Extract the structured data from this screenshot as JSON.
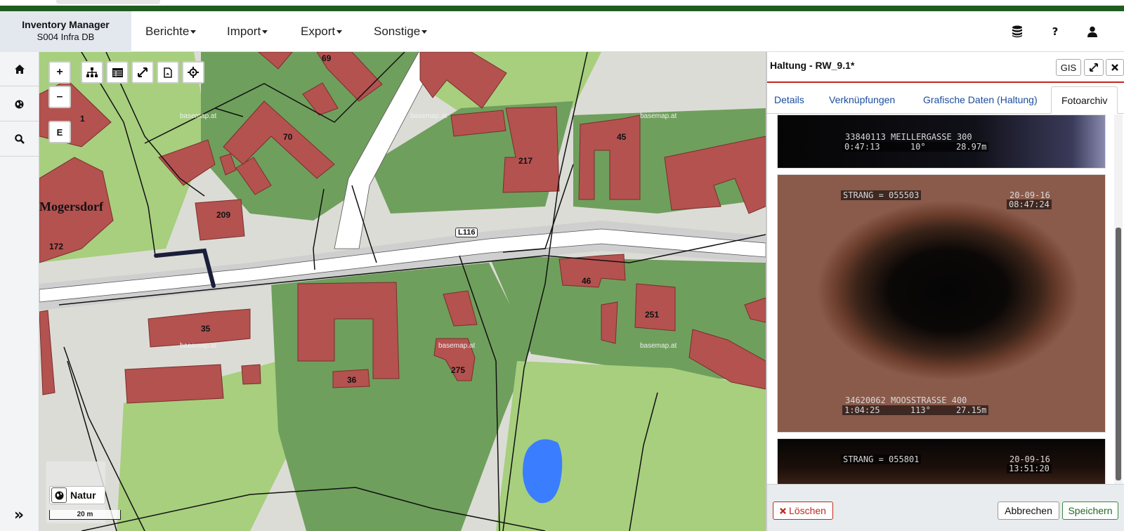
{
  "brand": {
    "title": "Inventory Manager",
    "subtitle": "S004 Infra DB"
  },
  "menu": [
    {
      "label": "Berichte"
    },
    {
      "label": "Import"
    },
    {
      "label": "Export"
    },
    {
      "label": "Sonstige"
    }
  ],
  "nav_icons": {
    "database": "database-icon",
    "help_label": "?",
    "user": "user-icon"
  },
  "sidebar": [
    "home-icon",
    "globe-icon",
    "search-icon"
  ],
  "map": {
    "toolbar": {
      "zoom_in": "+",
      "zoom_out": "–",
      "extent": "E"
    },
    "labels": {
      "town": "Mogersdorf",
      "road": "L116",
      "n69": "69",
      "n1": "1",
      "n70": "70",
      "n217": "217",
      "n45": "45",
      "n209": "209",
      "n172": "172",
      "n46": "46",
      "n251": "251",
      "n35": "35",
      "n275": "275",
      "n36": "36"
    },
    "watermark": "basemap.at",
    "layer": "Natur",
    "scale": "20 m",
    "colors": {
      "building": "#b45250",
      "green_dark": "#6f9f5c",
      "green_light": "#a7cf7e",
      "road": "#ffffff",
      "water": "#3a7dff"
    }
  },
  "panel": {
    "title": "Haltung - RW_9.1*",
    "gis_label": "GIS",
    "tabs": [
      {
        "label": "Details"
      },
      {
        "label": "Verknüpfungen"
      },
      {
        "label": "Grafische Daten (Haltung)"
      },
      {
        "label": "Fotoarchiv",
        "active": true
      }
    ],
    "photos": [
      {
        "line1": "33840113 MEILLERGASSE 300",
        "line2": "0:47:13      10°      28.97m"
      },
      {
        "strang": "STRANG = 055503",
        "date": "20-09-16",
        "time": "08:47:24",
        "line1": "34620062 MOOSSTRASSE 400",
        "line2": "1:04:25      113°     27.15m"
      },
      {
        "strang": "STRANG = 055801",
        "date": "20-09-16",
        "time": "13:51:20"
      }
    ],
    "footer": {
      "delete": "Löschen",
      "cancel": "Abbrechen",
      "save": "Speichern"
    }
  }
}
